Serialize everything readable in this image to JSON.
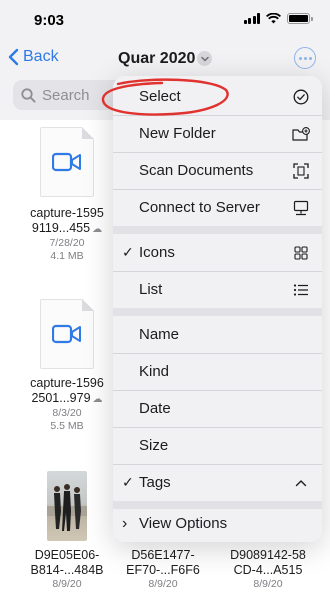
{
  "status_bar": {
    "time": "9:03"
  },
  "nav": {
    "back_label": "Back",
    "title": "Quar 2020"
  },
  "search": {
    "placeholder": "Search"
  },
  "files": [
    {
      "name_line1": "capture-1595",
      "name_line2": "9119...455",
      "date": "7/28/20",
      "size": "4.1 MB",
      "kind": "video"
    },
    {
      "name_line1": "capture-1596",
      "name_line2": "2501...979",
      "date": "8/3/20",
      "size": "5.5 MB",
      "kind": "video"
    },
    {
      "name_line1": "D9E05E06-",
      "name_line2": "B814-...484B",
      "date": "8/9/20",
      "kind": "photo"
    },
    {
      "name_line1": "D56E1477-",
      "name_line2": "EF70-...F6F6",
      "date": "8/9/20",
      "kind": "photo"
    },
    {
      "name_line1": "D9089142-58",
      "name_line2": "CD-4...A515",
      "date": "8/9/20",
      "kind": "photo"
    }
  ],
  "menu": {
    "select": "Select",
    "new_folder": "New Folder",
    "scan_documents": "Scan Documents",
    "connect_to_server": "Connect to Server",
    "icons": "Icons",
    "list": "List",
    "name": "Name",
    "kind": "Kind",
    "date": "Date",
    "size": "Size",
    "tags": "Tags",
    "view_options": "View Options",
    "checkmark": "✓",
    "view_options_chevron": "›"
  },
  "colors": {
    "accent": "#2f7ae5",
    "annotation": "#e0322e"
  }
}
